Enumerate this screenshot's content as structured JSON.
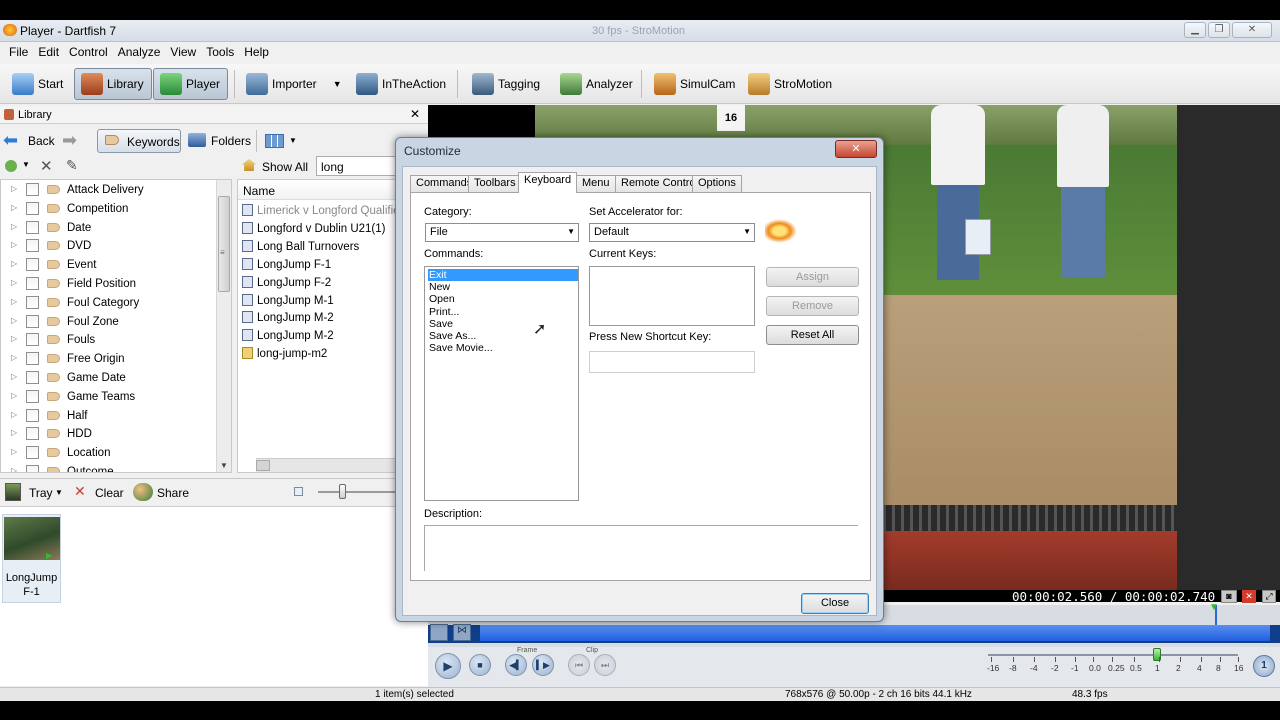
{
  "window": {
    "title": "Player - Dartfish 7",
    "ghost_title": "30 fps - StroMotion"
  },
  "menu": [
    "File",
    "Edit",
    "Control",
    "Analyze",
    "View",
    "Tools",
    "Help"
  ],
  "toolbar": {
    "items": [
      "Start",
      "Library",
      "Player",
      "Importer",
      "InTheAction",
      "Tagging",
      "Analyzer",
      "SimulCam",
      "StroMotion"
    ]
  },
  "library": {
    "header": "Library",
    "back": "Back",
    "keywords": "Keywords",
    "folders": "Folders",
    "show_all": "Show All",
    "search_value": "long",
    "column_name": "Name",
    "keyword_items": [
      "Attack Delivery",
      "Competition",
      "Date",
      "DVD",
      "Event",
      "Field Position",
      "Foul Category",
      "Foul Zone",
      "Fouls",
      "Free Origin",
      "Game Date",
      "Game Teams",
      "Half",
      "HDD",
      "Location",
      "Outcome"
    ],
    "files": [
      "Limerick v Longford Qualifie",
      "Longford v Dublin U21(1)",
      "Long Ball Turnovers",
      "LongJump F-1",
      "LongJump F-2",
      "LongJump M-1",
      "LongJump M-2",
      "LongJump M-2",
      "long-jump-m2"
    ]
  },
  "tray": {
    "tray": "Tray",
    "clear": "Clear",
    "share": "Share",
    "thumb_label_1": "LongJump",
    "thumb_label_2": "F-1"
  },
  "player": {
    "timecode": "00:00:02.560 / 00:00:02.740",
    "frame_label": "Frame",
    "clip_label": "Clip",
    "speeds": [
      "-16",
      "-8",
      "-4",
      "-2",
      "-1",
      "0.0",
      "0.25",
      "0.5",
      "1",
      "2",
      "4",
      "8",
      "16"
    ],
    "speed_badge": "1"
  },
  "status": {
    "selected": "1 item(s) selected",
    "format": "768x576 @ 50.00p - 2 ch 16 bits 44.1 kHz",
    "fps": "48.3 fps"
  },
  "dialog": {
    "title": "Customize",
    "close_x": "✕",
    "tabs": [
      "Commands",
      "Toolbars",
      "Keyboard",
      "Menu",
      "Remote Control",
      "Options"
    ],
    "active_tab": "Keyboard",
    "category_label": "Category:",
    "category_value": "File",
    "set_accel_label": "Set Accelerator for:",
    "set_accel_value": "Default",
    "commands_label": "Commands:",
    "commands": [
      "Exit",
      "New",
      "Open",
      "Print...",
      "Save",
      "Save As...",
      "Save Movie..."
    ],
    "selected_command": "Exit",
    "current_keys_label": "Current Keys:",
    "press_new_label": "Press New Shortcut Key:",
    "description_label": "Description:",
    "assign": "Assign",
    "remove": "Remove",
    "reset_all": "Reset All",
    "close": "Close"
  }
}
